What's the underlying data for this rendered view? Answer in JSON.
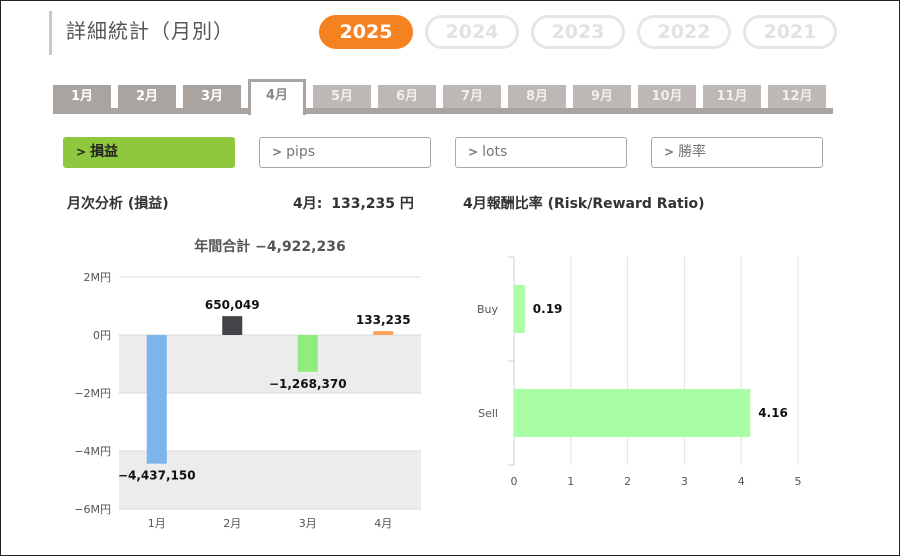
{
  "header": {
    "title": "詳細統計（月別）"
  },
  "years": [
    "2025",
    "2024",
    "2023",
    "2022",
    "2021"
  ],
  "selected_year": "2025",
  "months": [
    "1月",
    "2月",
    "3月",
    "4月",
    "5月",
    "6月",
    "7月",
    "8月",
    "9月",
    "10月",
    "11月",
    "12月"
  ],
  "selected_month": "4月",
  "metrics": [
    {
      "label": "損益",
      "active": true
    },
    {
      "label": "pips",
      "active": false
    },
    {
      "label": "lots",
      "active": false
    },
    {
      "label": "勝率",
      "active": false
    }
  ],
  "monthly_title": "月次分析 (損益)",
  "month_summary": {
    "prefix": "4月:",
    "value": "133,235 円"
  },
  "ratio_title": "4月報酬比率 (Risk/Reward Ratio)",
  "colors": {
    "accent": "#f58220",
    "metric_active": "#8fc73e"
  },
  "chart_data": [
    {
      "type": "bar",
      "title": "年間合計 −4,922,236",
      "categories": [
        "1月",
        "2月",
        "3月",
        "4月"
      ],
      "values": [
        -4437150,
        650049,
        -1268370,
        133235
      ],
      "value_labels": [
        "−4,437,150",
        "650,049",
        "−1,268,370",
        "133,235"
      ],
      "bar_colors": [
        "#7cb5ec",
        "#434348",
        "#90ed7d",
        "#f7a35c"
      ],
      "ylim": [
        -6000000,
        2000000
      ],
      "yticks": [
        2000000,
        0,
        -2000000,
        -4000000,
        -6000000
      ],
      "ytick_labels": [
        "2M円",
        "0円",
        "−2M円",
        "−4M円",
        "−6M円"
      ],
      "grid": true
    },
    {
      "type": "bar",
      "orientation": "horizontal",
      "categories": [
        "Buy",
        "Sell"
      ],
      "values": [
        0.19,
        4.16
      ],
      "value_labels": [
        "0.19",
        "4.16"
      ],
      "bar_color": "#aaffa6",
      "xlim": [
        0,
        5
      ],
      "xticks": [
        0,
        1,
        2,
        3,
        4,
        5
      ],
      "grid": true
    }
  ]
}
